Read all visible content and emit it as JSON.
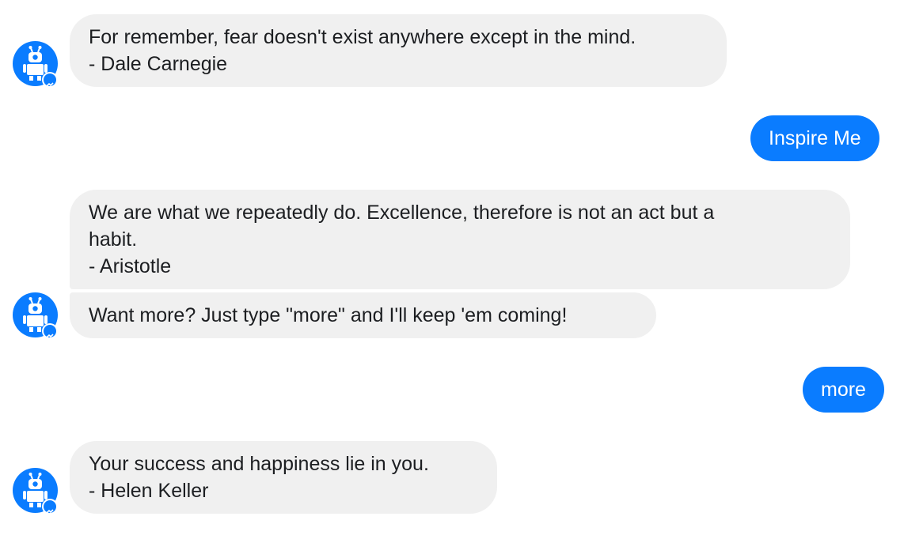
{
  "messages": [
    {
      "sender": "bot",
      "lines": [
        "For remember, fear doesn't exist anywhere except in the mind.",
        "- Dale Carnegie"
      ]
    },
    {
      "sender": "user",
      "text": "Inspire Me"
    },
    {
      "sender": "bot",
      "lines": [
        "We are what we repeatedly do. Excellence, therefore is not an act but a",
        "habit.",
        "- Aristotle"
      ]
    },
    {
      "sender": "bot",
      "text": "Want more? Just type \"more\" and I'll keep 'em coming!"
    },
    {
      "sender": "user",
      "text": "more"
    },
    {
      "sender": "bot",
      "lines": [
        "Your success and happiness lie in you.",
        "- Helen Keller"
      ]
    }
  ],
  "icons": {
    "bot_avatar": "robot-icon",
    "platform_badge": "messenger-icon"
  },
  "colors": {
    "user_bubble": "#0a7cff",
    "bot_bubble": "#f0f0f0",
    "avatar": "#0a7cff"
  }
}
